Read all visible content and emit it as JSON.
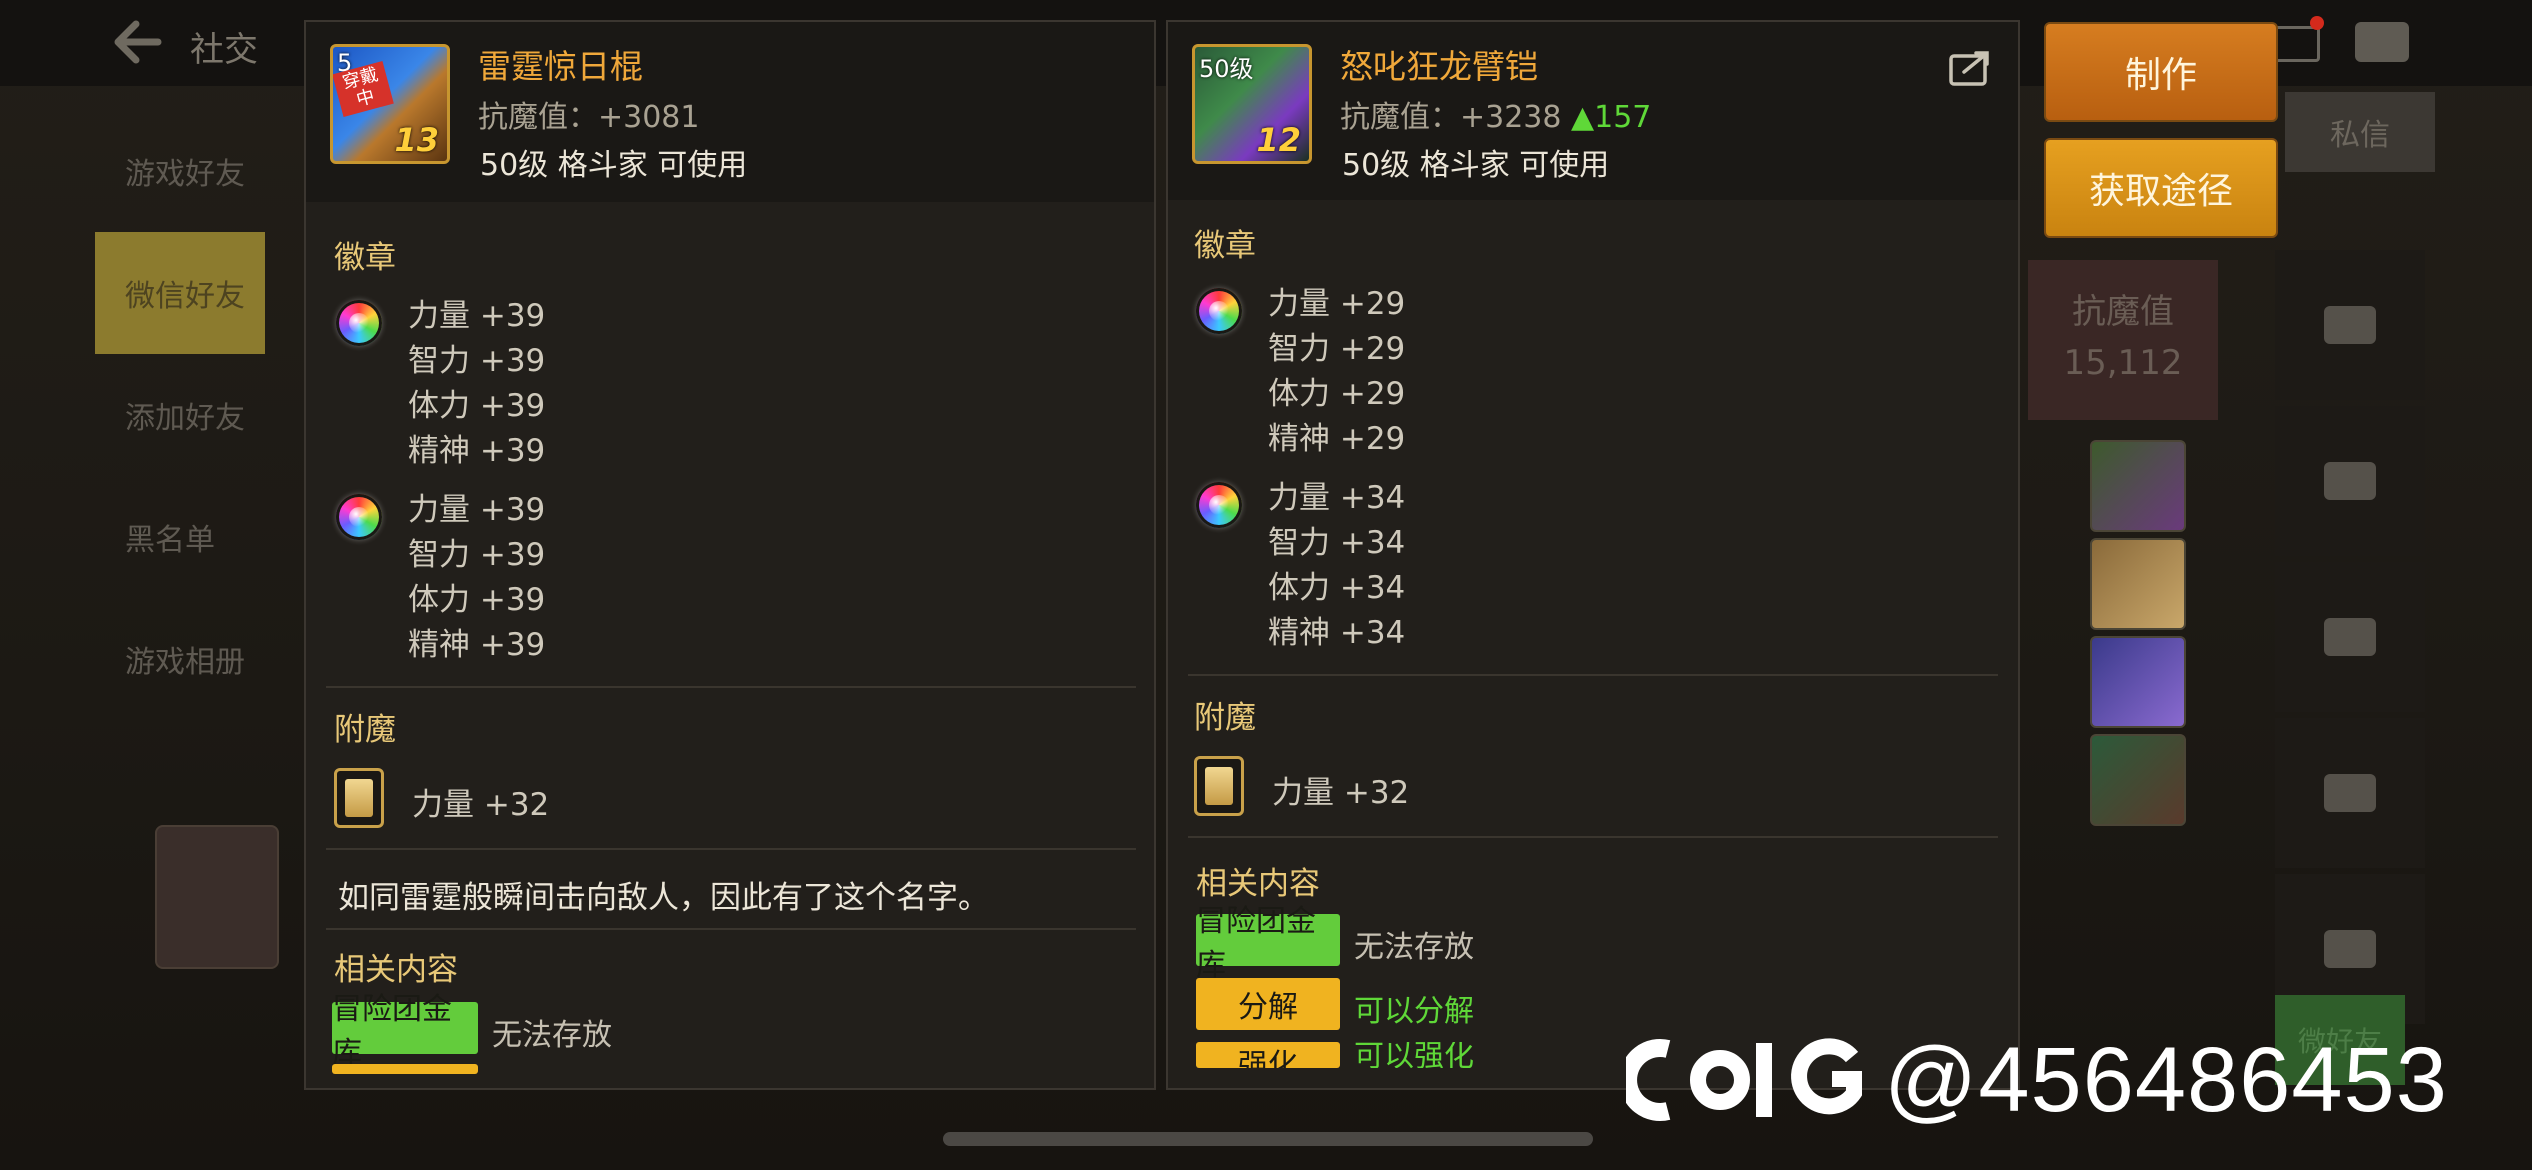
{
  "background": {
    "top_title": "社交",
    "nav": [
      "游戏好友",
      "微信好友",
      "添加好友",
      "黑名单",
      "游戏相册"
    ],
    "private_tab": "私信",
    "stat_label": "抗魔值",
    "stat_value": "15,112",
    "friend_button": "微好友"
  },
  "left_item": {
    "name": "雷霆惊日棍",
    "level_badge": "5",
    "wearing_tag": "穿戴中",
    "refine": "13",
    "antimagic": "抗魔值：+3081",
    "usage": "50级 格斗家 可使用",
    "badge_title": "徽章",
    "badge_groups": [
      [
        "力量 +39",
        "智力 +39",
        "体力 +39",
        "精神 +39"
      ],
      [
        "力量 +39",
        "智力 +39",
        "体力 +39",
        "精神 +39"
      ]
    ],
    "enchant_title": "附魔",
    "enchant": "力量 +32",
    "flavor": "如同雷霆般瞬间击向敌人，因此有了这个名字。",
    "related_title": "相关内容",
    "related": [
      {
        "tag": "冒险团金库",
        "value": "无法存放",
        "tag_color": "green",
        "value_color": "gray"
      }
    ]
  },
  "right_item": {
    "name": "怒叱狂龙臂铠",
    "level_badge": "50级",
    "refine": "12",
    "antimagic": "抗魔值：+3238",
    "antimagic_delta": "▲157",
    "usage": "50级 格斗家 可使用",
    "badge_title": "徽章",
    "badge_groups": [
      [
        "力量 +29",
        "智力 +29",
        "体力 +29",
        "精神 +29"
      ],
      [
        "力量 +34",
        "智力 +34",
        "体力 +34",
        "精神 +34"
      ]
    ],
    "enchant_title": "附魔",
    "enchant": "力量 +32",
    "related_title": "相关内容",
    "related": [
      {
        "tag": "冒险团金库",
        "value": "无法存放",
        "tag_color": "green",
        "value_color": "gray"
      },
      {
        "tag": "分解",
        "value": "可以分解",
        "tag_color": "yellow",
        "value_color": "green"
      },
      {
        "tag": "强化",
        "value": "可以强化",
        "tag_color": "yellow",
        "value_color": "green"
      }
    ]
  },
  "buttons": {
    "craft": "制作",
    "source": "获取途径"
  },
  "watermark": {
    "logo_text": "COLG",
    "handle": "@456486453"
  },
  "colors": {
    "item_name": "#f0a83a",
    "section_title": "#e8c878",
    "delta_green": "#5fd838",
    "craft_button": "#c86c18",
    "source_button": "#d89218"
  }
}
